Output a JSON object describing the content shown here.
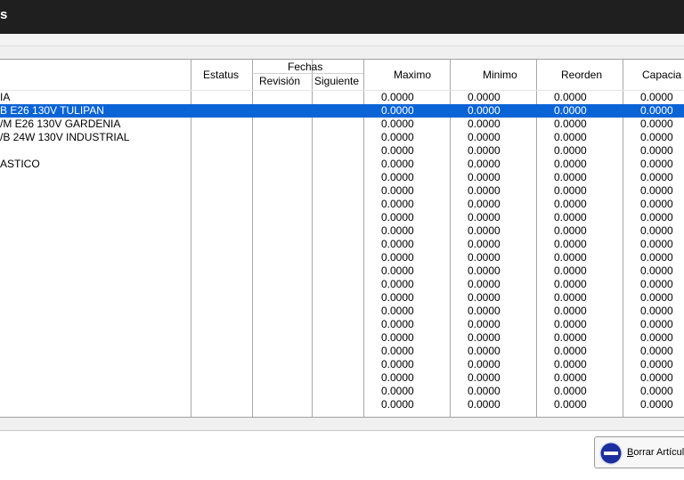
{
  "window": {
    "title": "s"
  },
  "columns": {
    "estatus": "Estatus",
    "fechas": "Fechas",
    "revision": "Revisión",
    "siguiente": "Siguiente",
    "maximo": "Maximo",
    "minimo": "Minimo",
    "reorden": "Reorden",
    "capacidad": "Capacia"
  },
  "rows": [
    {
      "desc": "IA",
      "max": "0.0000",
      "min": "0.0000",
      "reo": "0.0000",
      "cap": "0.0000"
    },
    {
      "desc": "B E26 130V TULIPAN",
      "max": "0.0000",
      "min": "0.0000",
      "reo": "0.0000",
      "cap": "0.0000",
      "selected": true
    },
    {
      "desc": "/M E26 130V GARDENIA",
      "max": "0.0000",
      "min": "0.0000",
      "reo": "0.0000",
      "cap": "0.0000"
    },
    {
      "desc": "/B 24W 130V INDUSTRIAL",
      "max": "0.0000",
      "min": "0.0000",
      "reo": "0.0000",
      "cap": "0.0000"
    },
    {
      "desc": "",
      "max": "0.0000",
      "min": "0.0000",
      "reo": "0.0000",
      "cap": "0.0000"
    },
    {
      "desc": "ASTICO",
      "max": "0.0000",
      "min": "0.0000",
      "reo": "0.0000",
      "cap": "0.0000"
    },
    {
      "desc": "",
      "max": "0.0000",
      "min": "0.0000",
      "reo": "0.0000",
      "cap": "0.0000"
    },
    {
      "desc": "",
      "max": "0.0000",
      "min": "0.0000",
      "reo": "0.0000",
      "cap": "0.0000"
    },
    {
      "desc": "",
      "max": "0.0000",
      "min": "0.0000",
      "reo": "0.0000",
      "cap": "0.0000"
    },
    {
      "desc": "",
      "max": "0.0000",
      "min": "0.0000",
      "reo": "0.0000",
      "cap": "0.0000"
    },
    {
      "desc": "",
      "max": "0.0000",
      "min": "0.0000",
      "reo": "0.0000",
      "cap": "0.0000"
    },
    {
      "desc": "",
      "max": "0.0000",
      "min": "0.0000",
      "reo": "0.0000",
      "cap": "0.0000"
    },
    {
      "desc": "",
      "max": "0.0000",
      "min": "0.0000",
      "reo": "0.0000",
      "cap": "0.0000"
    },
    {
      "desc": "",
      "max": "0.0000",
      "min": "0.0000",
      "reo": "0.0000",
      "cap": "0.0000"
    },
    {
      "desc": "",
      "max": "0.0000",
      "min": "0.0000",
      "reo": "0.0000",
      "cap": "0.0000"
    },
    {
      "desc": "",
      "max": "0.0000",
      "min": "0.0000",
      "reo": "0.0000",
      "cap": "0.0000"
    },
    {
      "desc": "",
      "max": "0.0000",
      "min": "0.0000",
      "reo": "0.0000",
      "cap": "0.0000"
    },
    {
      "desc": "",
      "max": "0.0000",
      "min": "0.0000",
      "reo": "0.0000",
      "cap": "0.0000"
    },
    {
      "desc": "",
      "max": "0.0000",
      "min": "0.0000",
      "reo": "0.0000",
      "cap": "0.0000"
    },
    {
      "desc": "",
      "max": "0.0000",
      "min": "0.0000",
      "reo": "0.0000",
      "cap": "0.0000"
    },
    {
      "desc": "",
      "max": "0.0000",
      "min": "0.0000",
      "reo": "0.0000",
      "cap": "0.0000"
    },
    {
      "desc": "",
      "max": "0.0000",
      "min": "0.0000",
      "reo": "0.0000",
      "cap": "0.0000"
    },
    {
      "desc": "",
      "max": "0.0000",
      "min": "0.0000",
      "reo": "0.0000",
      "cap": "0.0000"
    },
    {
      "desc": "",
      "max": "0.0000",
      "min": "0.0000",
      "reo": "0.0000",
      "cap": "0.0000"
    }
  ],
  "footer": {
    "delete_button": {
      "underlined": "B",
      "rest": "orrar Artículo",
      "icon": "no-entry-icon"
    }
  },
  "colors": {
    "titlebar": "#1f1f1f",
    "selection": "#0a64d6",
    "delete_icon": "#1c2f9e"
  }
}
